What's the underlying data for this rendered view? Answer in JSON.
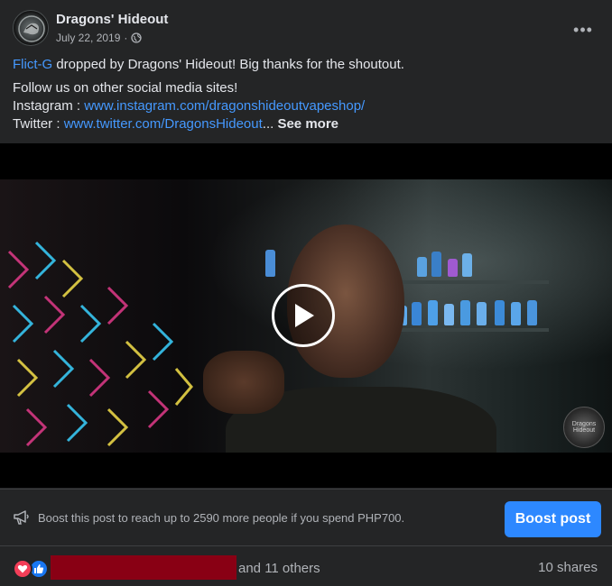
{
  "post": {
    "page_name": "Dragons' Hideout",
    "date": "July 22, 2019",
    "audience_icon": "globe-icon",
    "more_icon": "more-horizontal-icon",
    "more_label": "•••"
  },
  "body": {
    "mention": "Flict-G",
    "line1_rest": " dropped by Dragons' Hideout! Big thanks for the shoutout.",
    "line2": "Follow us on other social media sites!",
    "instagram_label": "Instagram : ",
    "instagram_link": "www.instagram.com/dragonshideoutvapeshop/",
    "twitter_label": "Twitter : ",
    "twitter_link": "www.twitter.com/DragonsHideout",
    "ellipsis": "...",
    "see_more": " See more"
  },
  "video": {
    "play_icon": "play-icon",
    "watermark_text": "Dragons Hideout"
  },
  "boost": {
    "icon": "megaphone-icon",
    "text": "Boost this post to reach up to 2590 more people if you spend PHP700.",
    "button_label": "Boost post"
  },
  "reactions": {
    "icons": [
      "love-icon",
      "like-icon"
    ],
    "others_text": "and 11 others",
    "shares_text": "10 shares"
  },
  "colors": {
    "background": "#242526",
    "link": "#4599ff",
    "boost_button": "#2d88ff",
    "love": "#f33e58",
    "like": "#1877f2",
    "redaction": "#890014"
  }
}
